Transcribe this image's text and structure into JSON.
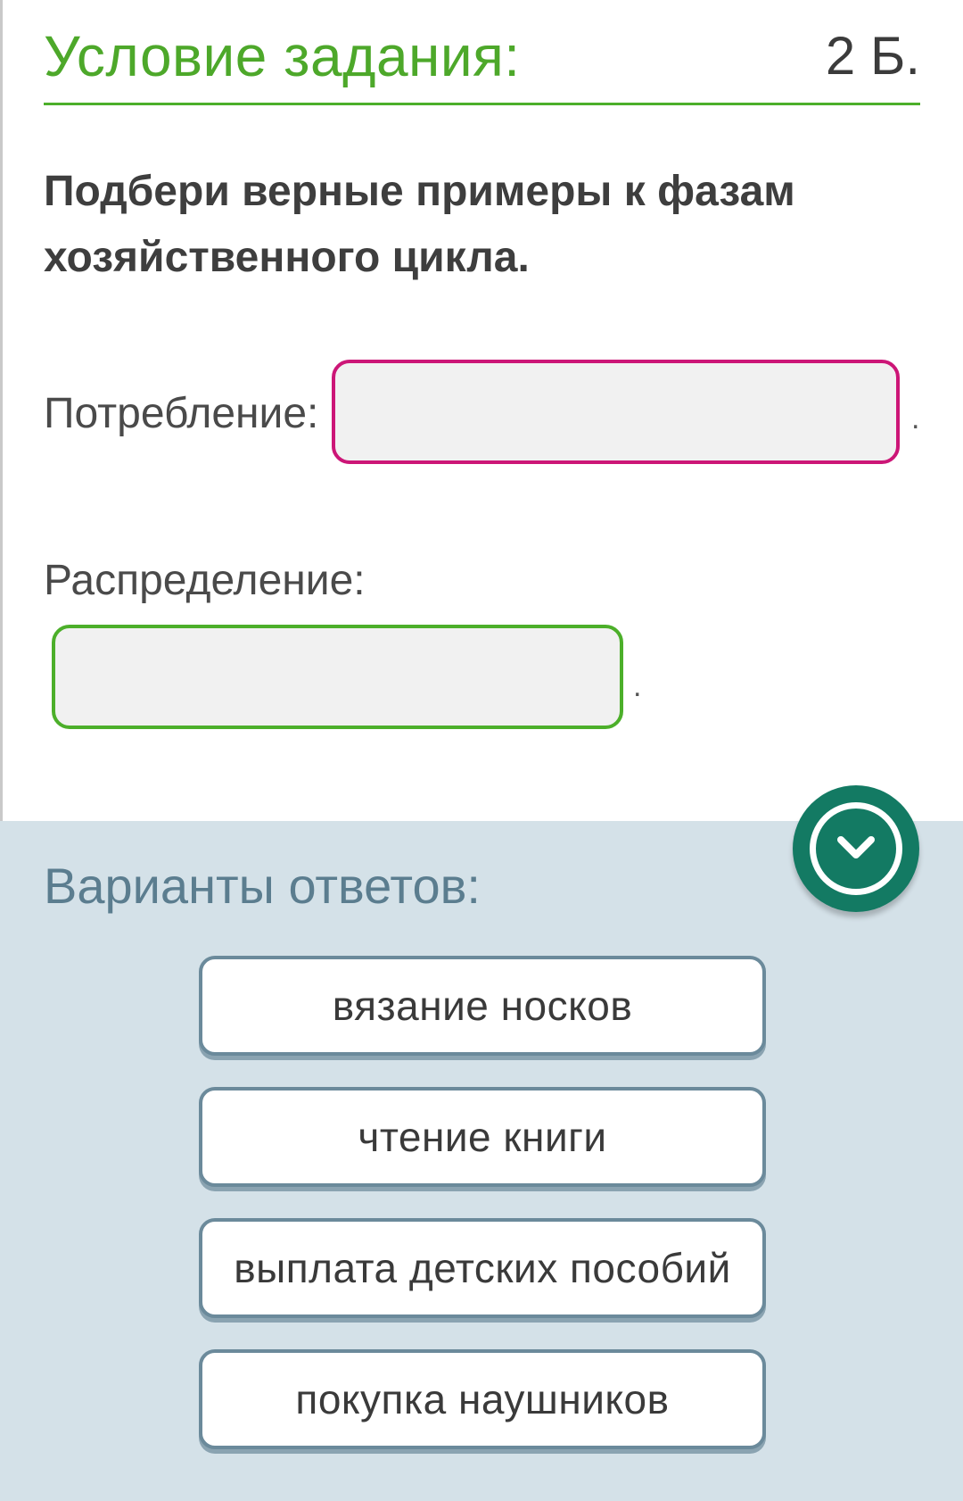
{
  "header": {
    "title": "Условие задания:",
    "points": "2 Б."
  },
  "question": {
    "text": "Подбери верные примеры к фазам хозяйственного цикла."
  },
  "fields": [
    {
      "label": "Потребление:",
      "value": "",
      "suffix": "."
    },
    {
      "label": "Распределение:",
      "value": "",
      "suffix": "."
    }
  ],
  "options_panel": {
    "title": "Варианты ответов:",
    "collapse_icon": "chevron-down-circle-icon",
    "items": [
      {
        "label": "вязание носков"
      },
      {
        "label": "чтение книги"
      },
      {
        "label": "выплата детских пособий"
      },
      {
        "label": "покупка наушников"
      }
    ]
  },
  "colors": {
    "accent_green": "#4caf2a",
    "field_pink": "#cc1677",
    "panel_bg": "#d4e1e8",
    "button_teal": "#137a63",
    "option_border": "#6b8a9b"
  }
}
